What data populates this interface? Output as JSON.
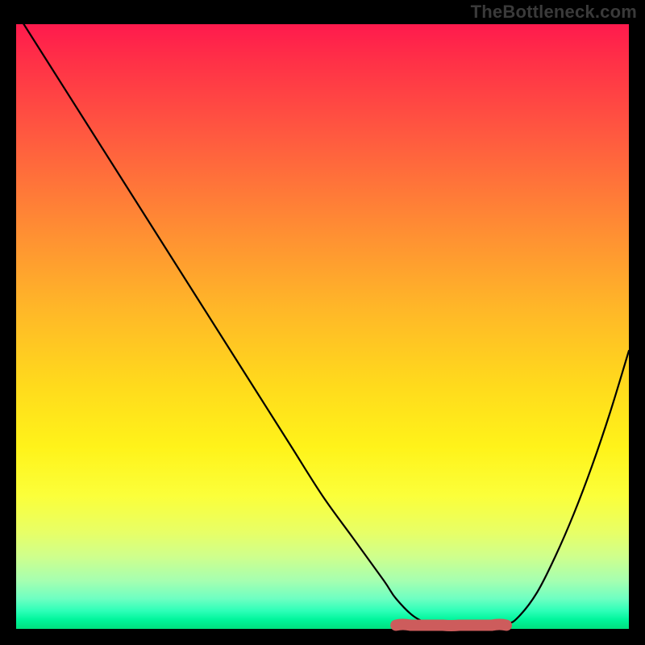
{
  "watermark": "TheBottleneck.com",
  "chart_data": {
    "type": "line",
    "title": "",
    "xlabel": "",
    "ylabel": "",
    "xlim": [
      0,
      100
    ],
    "ylim": [
      0,
      100
    ],
    "background_gradient": {
      "top": "#ff1a4d",
      "bottom": "#00e07e",
      "meaning": "high-to-low bottleneck severity"
    },
    "series": [
      {
        "name": "bottleneck-curve",
        "x": [
          0,
          5,
          10,
          15,
          20,
          25,
          30,
          35,
          40,
          45,
          50,
          55,
          60,
          62,
          65,
          68,
          72,
          76,
          80,
          82,
          85,
          88,
          91,
          94,
          97,
          100
        ],
        "y": [
          102,
          94,
          86,
          78,
          70,
          62,
          54,
          46,
          38,
          30,
          22,
          15,
          8,
          5,
          2,
          0.8,
          0.4,
          0.4,
          0.8,
          2,
          6,
          12,
          19,
          27,
          36,
          46
        ]
      }
    ],
    "optimal_band": {
      "name": "optimal-range-marker",
      "color": "#cd5c5c",
      "x_start": 62,
      "x_end": 80,
      "y": 0.6
    }
  }
}
